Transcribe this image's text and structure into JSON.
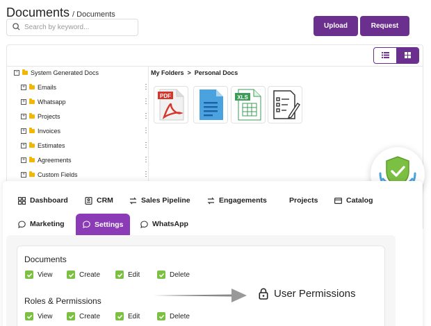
{
  "header": {
    "title": "Documents",
    "crumb": "/ Documents",
    "search_placeholder": "Search by keyword...",
    "upload_label": "Upload",
    "request_label": "Request"
  },
  "tree": {
    "root": "System Generated Docs",
    "items": [
      "Emails",
      "Whatsapp",
      "Projects",
      "Invoices",
      "Estimates",
      "Agreements",
      "Custom Fields"
    ]
  },
  "folder_path": "My Folders  >  Personal Docs",
  "files": [
    {
      "type": "PDF",
      "icon": "pdf-file-icon"
    },
    {
      "type": "",
      "icon": "doc-file-icon"
    },
    {
      "type": "XLS",
      "icon": "xls-file-icon"
    },
    {
      "type": "",
      "icon": "form-file-icon"
    }
  ],
  "nav": {
    "row1": [
      "Dashboard",
      "CRM",
      "Sales Pipeline",
      "Engagements",
      "Projects",
      "Catalog"
    ],
    "row2": [
      "Marketing",
      "Settings",
      "WhatsApp"
    ],
    "active": "Settings"
  },
  "permissions": {
    "sections": [
      {
        "title": "Documents",
        "items": [
          "View",
          "Create",
          "Edit",
          "Delete"
        ]
      },
      {
        "title": "Roles & Permissions",
        "items": [
          "View",
          "Create",
          "Edit",
          "Delete"
        ]
      }
    ],
    "callout": "User Permissions"
  },
  "colors": {
    "accent": "#6b2f8e",
    "active_tab": "#8a3bb5",
    "check": "#7cc043",
    "shield": "#7cc043",
    "hands": "#4aa3df"
  }
}
